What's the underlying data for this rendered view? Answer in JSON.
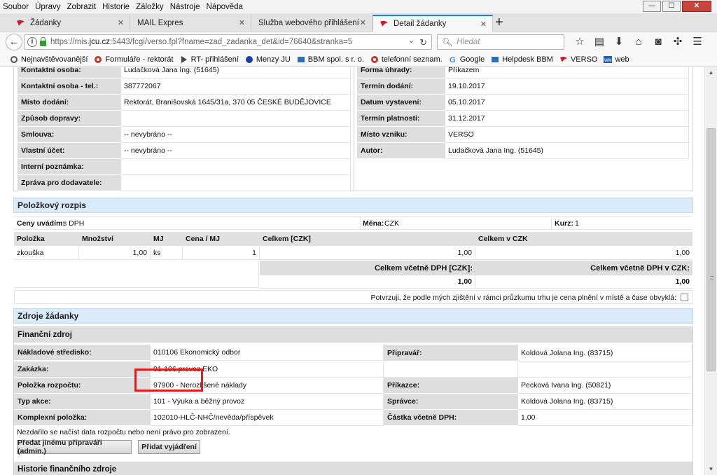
{
  "browser": {
    "menu": [
      "Soubor",
      "Úpravy",
      "Zobrazit",
      "Historie",
      "Záložky",
      "Nástroje",
      "Nápověda"
    ],
    "window_controls": {
      "minimize": "—",
      "maximize": "☐",
      "close": "✕"
    },
    "tabs": [
      {
        "label": "Žádanky"
      },
      {
        "label": "MAIL Expres"
      },
      {
        "label": "Služba webového přihlášení"
      },
      {
        "label": "Detail žádanky"
      }
    ],
    "url_prefix": "https://mis.",
    "url_domain": "jcu.cz",
    "url_rest": ":5443/fcgi/verso.fpl?fname=zad_zadanka_det&id=76640&stranka=5",
    "search_placeholder": "Hledat",
    "bookmarks": [
      "Nejnavštěvovanější",
      "Formuláře - rektorát",
      "RT- přihlášení",
      "Menzy JU",
      "BBM spol. s r. o.",
      "telefonní seznam.",
      "Google",
      "Helpdesk BBM",
      "VERSO",
      "web"
    ]
  },
  "header_info": {
    "left": [
      {
        "label": "Kontaktní osoba:",
        "value": "Ludačková Jana Ing. (51645)"
      },
      {
        "label": "Kontaktní osoba - tel.:",
        "value": "387772067"
      },
      {
        "label": "Místo dodání:",
        "value": "Rektorát, Branišovská 1645/31a, 370 05 ČESKÉ BUDĚJOVICE"
      },
      {
        "label": "Způsob dopravy:",
        "value": ""
      },
      {
        "label": "Smlouva:",
        "value": "-- nevybráno --"
      },
      {
        "label": "Vlastní účet:",
        "value": "-- nevybráno --"
      },
      {
        "label": "Interní poznámka:",
        "value": ""
      },
      {
        "label": "Zpráva pro dodavatele:",
        "value": ""
      }
    ],
    "right": [
      {
        "label": "Forma úhrady:",
        "value": "Příkazem"
      },
      {
        "label": "Termín dodání:",
        "value": "19.10.2017"
      },
      {
        "label": "Datum vystavení:",
        "value": "05.10.2017"
      },
      {
        "label": "Termín platnosti:",
        "value": "31.12.2017"
      },
      {
        "label": "Místo vzniku:",
        "value": "VERSO"
      },
      {
        "label": "Autor:",
        "value": "Ludačková Jana Ing. (51645)"
      }
    ]
  },
  "items": {
    "title": "Položkový rozpis",
    "prices_label": "Ceny uvádím:",
    "prices_value": "s DPH",
    "currency_label": "Měna:",
    "currency_value": "CZK",
    "rate_label": "Kurz:",
    "rate_value": "1",
    "columns": [
      "Položka",
      "Množství",
      "MJ",
      "Cena / MJ",
      "Celkem [CZK]",
      "Celkem v CZK"
    ],
    "rows": [
      {
        "item": "zkouška",
        "qty": "1,00",
        "unit": "ks",
        "price": "1",
        "total_czk": "1,00",
        "total_in_czk": "1,00"
      }
    ],
    "total_vat_czk_label": "Celkem včetně DPH [CZK]:",
    "total_vat_in_czk_label": "Celkem včetně DPH v CZK:",
    "total_vat_czk": "1,00",
    "total_vat_in_czk": "1,00",
    "confirm_text": "Potvrzuji, že podle mých zjištění v rámci průzkumu trhu je cena plnění v místě a čase obvyklá:"
  },
  "sources": {
    "title": "Zdroje žádanky",
    "subtitle": "Finanční zdroj",
    "left": [
      {
        "label": "Nákladové středisko:",
        "value": "010106 Ekonomický odbor"
      },
      {
        "label": "Zakázka:",
        "value": "01-106 provoz EKO"
      },
      {
        "label": "Položka rozpočtu:",
        "value": "97900 - Nerozlišené náklady"
      },
      {
        "label": "Typ akce:",
        "value": "101 - Výuka a běžný provoz"
      },
      {
        "label": "Komplexní položka:",
        "value": "102010-HLČ-NHČ/nevěda/příspěvek"
      }
    ],
    "right": [
      {
        "label": "Připravář:",
        "value": "Koldová Jolana Ing. (83715)"
      },
      {
        "label": "",
        "value": ""
      },
      {
        "label": "Příkazce:",
        "value": "Pecková Ivana Ing. (50821)"
      },
      {
        "label": "Správce:",
        "value": "Koldová Jolana Ing. (83715)"
      },
      {
        "label": "Částka včetně DPH:",
        "value": "1,00"
      }
    ],
    "budget_note": "Nezdařilo se načíst data rozpočtu nebo není právo pro zobrazení.",
    "btn_pass": "Předat jinému připraváři (admin.)",
    "btn_add": "Přidat vyjádření",
    "history_title": "Historie finančního zdroje"
  }
}
